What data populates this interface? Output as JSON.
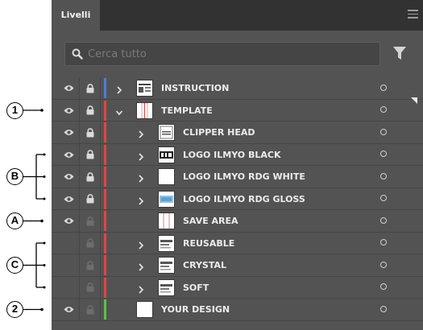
{
  "panel": {
    "tab_label": "Livelli",
    "menu_icon": "hamburger-menu-icon",
    "search": {
      "placeholder": "Cerca tutto",
      "value": ""
    },
    "filter_icon": "filter-funnel-icon"
  },
  "colors": {
    "panel_bg": "#535353",
    "tabbar_bg": "#323232",
    "layer_blue": "#4f7dd6",
    "layer_red": "#e04545",
    "layer_green": "#5cc146"
  },
  "layers": [
    {
      "name": "INSTRUCTION",
      "visible": true,
      "locked": true,
      "color": "#4f7dd6",
      "expandable": true,
      "expanded": false,
      "indent": 0,
      "thumb": "instruction"
    },
    {
      "name": "TEMPLATE",
      "visible": true,
      "locked": true,
      "color": "#e04545",
      "expandable": true,
      "expanded": true,
      "indent": 0,
      "thumb": "template"
    },
    {
      "name": "CLIPPER HEAD",
      "visible": true,
      "locked": true,
      "color": "#e04545",
      "expandable": true,
      "expanded": false,
      "indent": 1,
      "thumb": "clipper"
    },
    {
      "name": "LOGO ILMYO BLACK",
      "visible": true,
      "locked": true,
      "color": "#e04545",
      "expandable": true,
      "expanded": false,
      "indent": 1,
      "thumb": "logo_black"
    },
    {
      "name": "LOGO ILMYO RDG WHITE",
      "visible": true,
      "locked": true,
      "color": "#e04545",
      "expandable": true,
      "expanded": false,
      "indent": 1,
      "thumb": "blank"
    },
    {
      "name": "LOGO ILMYO RDG GLOSS",
      "visible": true,
      "locked": true,
      "color": "#e04545",
      "expandable": true,
      "expanded": false,
      "indent": 1,
      "thumb": "logo_gloss"
    },
    {
      "name": "SAVE AREA",
      "visible": true,
      "locked": false,
      "color": "#e04545",
      "expandable": false,
      "expanded": false,
      "indent": 1,
      "thumb": "savearea"
    },
    {
      "name": "REUSABLE",
      "visible": false,
      "locked": false,
      "color": "#e04545",
      "expandable": true,
      "expanded": false,
      "indent": 1,
      "thumb": "text"
    },
    {
      "name": "CRYSTAL",
      "visible": false,
      "locked": false,
      "color": "#e04545",
      "expandable": true,
      "expanded": false,
      "indent": 1,
      "thumb": "text"
    },
    {
      "name": "SOFT",
      "visible": false,
      "locked": false,
      "color": "#e04545",
      "expandable": true,
      "expanded": false,
      "indent": 1,
      "thumb": "text"
    },
    {
      "name": "YOUR DESIGN",
      "visible": true,
      "locked": false,
      "color": "#5cc146",
      "expandable": false,
      "expanded": false,
      "indent": 0,
      "thumb": "blank"
    }
  ],
  "callouts": [
    {
      "label": "1",
      "rows": [
        1
      ]
    },
    {
      "label": "B",
      "rows": [
        3,
        4,
        5
      ]
    },
    {
      "label": "A",
      "rows": [
        6
      ]
    },
    {
      "label": "C",
      "rows": [
        7,
        8,
        9
      ]
    },
    {
      "label": "2",
      "rows": [
        10
      ]
    }
  ]
}
